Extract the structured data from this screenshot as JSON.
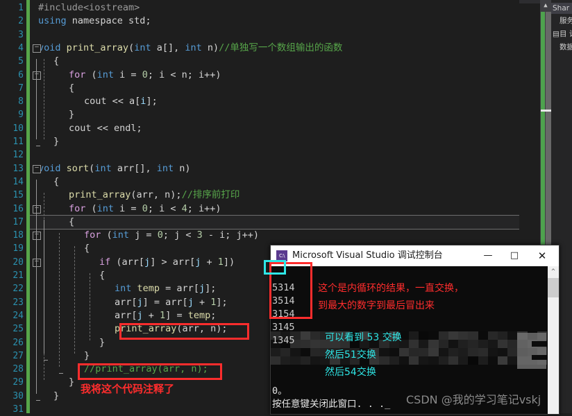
{
  "editor": {
    "language": "cpp",
    "first_line": 1,
    "last_line": 31,
    "current_line": 17,
    "line_numbers": [
      "1",
      "2",
      "3",
      "4",
      "5",
      "6",
      "7",
      "8",
      "9",
      "10",
      "11",
      "12",
      "13",
      "14",
      "15",
      "16",
      "17",
      "18",
      "19",
      "20",
      "21",
      "22",
      "23",
      "24",
      "25",
      "26",
      "27",
      "28",
      "29",
      "30",
      "31"
    ],
    "code_lines": [
      {
        "n": 1,
        "indent": 0,
        "tokens": [
          {
            "t": "#include<iostream>",
            "c": "pre"
          }
        ]
      },
      {
        "n": 2,
        "indent": 0,
        "tokens": [
          {
            "t": "using",
            "c": "kw"
          },
          {
            "t": " namespace ",
            "c": "id"
          },
          {
            "t": "std",
            "c": "id"
          },
          {
            "t": ";",
            "c": "br"
          }
        ]
      },
      {
        "n": 3,
        "indent": 0,
        "tokens": []
      },
      {
        "n": 4,
        "indent": 0,
        "tokens": [
          {
            "t": "void",
            "c": "kw"
          },
          {
            "t": " ",
            "c": "id"
          },
          {
            "t": "print_array",
            "c": "fn"
          },
          {
            "t": "(",
            "c": "br"
          },
          {
            "t": "int",
            "c": "kw"
          },
          {
            "t": " a[], ",
            "c": "id"
          },
          {
            "t": "int",
            "c": "kw"
          },
          {
            "t": " n",
            "c": "id"
          },
          {
            "t": ")",
            "c": "br"
          },
          {
            "t": "//单独写一个数组输出的函数",
            "c": "cmt"
          }
        ]
      },
      {
        "n": 5,
        "indent": 1,
        "tokens": [
          {
            "t": "{",
            "c": "br"
          }
        ]
      },
      {
        "n": 6,
        "indent": 2,
        "tokens": [
          {
            "t": "for",
            "c": "kw2"
          },
          {
            "t": " (",
            "c": "br"
          },
          {
            "t": "int",
            "c": "kw"
          },
          {
            "t": " i = ",
            "c": "id"
          },
          {
            "t": "0",
            "c": "num"
          },
          {
            "t": "; i < n; i++)",
            "c": "id"
          }
        ]
      },
      {
        "n": 7,
        "indent": 2,
        "tokens": [
          {
            "t": "{",
            "c": "br"
          }
        ]
      },
      {
        "n": 8,
        "indent": 3,
        "tokens": [
          {
            "t": "cout",
            "c": "id"
          },
          {
            "t": " << a[",
            "c": "id"
          },
          {
            "t": "i",
            "c": "var"
          },
          {
            "t": "];",
            "c": "id"
          }
        ]
      },
      {
        "n": 9,
        "indent": 2,
        "tokens": [
          {
            "t": "}",
            "c": "br"
          }
        ]
      },
      {
        "n": 10,
        "indent": 2,
        "tokens": [
          {
            "t": "cout",
            "c": "id"
          },
          {
            "t": " << endl;",
            "c": "id"
          }
        ]
      },
      {
        "n": 11,
        "indent": 1,
        "tokens": [
          {
            "t": "}",
            "c": "br"
          }
        ]
      },
      {
        "n": 12,
        "indent": 0,
        "tokens": []
      },
      {
        "n": 13,
        "indent": 0,
        "tokens": [
          {
            "t": "void",
            "c": "kw"
          },
          {
            "t": " ",
            "c": "id"
          },
          {
            "t": "sort",
            "c": "fn"
          },
          {
            "t": "(",
            "c": "br"
          },
          {
            "t": "int",
            "c": "kw"
          },
          {
            "t": " arr[], ",
            "c": "id"
          },
          {
            "t": "int",
            "c": "kw"
          },
          {
            "t": " n",
            "c": "id"
          },
          {
            "t": ")",
            "c": "br"
          }
        ]
      },
      {
        "n": 14,
        "indent": 1,
        "tokens": [
          {
            "t": "{",
            "c": "br"
          }
        ]
      },
      {
        "n": 15,
        "indent": 2,
        "tokens": [
          {
            "t": "print_array",
            "c": "fn"
          },
          {
            "t": "(arr, n);",
            "c": "id"
          },
          {
            "t": "//排序前打印",
            "c": "cmt"
          }
        ]
      },
      {
        "n": 16,
        "indent": 2,
        "tokens": [
          {
            "t": "for",
            "c": "kw2"
          },
          {
            "t": " (",
            "c": "br"
          },
          {
            "t": "int",
            "c": "kw"
          },
          {
            "t": " i = ",
            "c": "id"
          },
          {
            "t": "0",
            "c": "num"
          },
          {
            "t": "; i < ",
            "c": "id"
          },
          {
            "t": "4",
            "c": "num"
          },
          {
            "t": "; i++)",
            "c": "id"
          }
        ]
      },
      {
        "n": 17,
        "indent": 2,
        "tokens": [
          {
            "t": "{",
            "c": "br"
          }
        ]
      },
      {
        "n": 18,
        "indent": 3,
        "tokens": [
          {
            "t": "for",
            "c": "kw2"
          },
          {
            "t": " (",
            "c": "br"
          },
          {
            "t": "int",
            "c": "kw"
          },
          {
            "t": " j = ",
            "c": "id"
          },
          {
            "t": "0",
            "c": "num"
          },
          {
            "t": "; j < ",
            "c": "id"
          },
          {
            "t": "3",
            "c": "num"
          },
          {
            "t": " - i; j++)",
            "c": "id"
          }
        ]
      },
      {
        "n": 19,
        "indent": 3,
        "tokens": [
          {
            "t": "{",
            "c": "br"
          }
        ]
      },
      {
        "n": 20,
        "indent": 4,
        "tokens": [
          {
            "t": "if",
            "c": "kw2"
          },
          {
            "t": " (arr[",
            "c": "id"
          },
          {
            "t": "j",
            "c": "var"
          },
          {
            "t": "] > arr[",
            "c": "id"
          },
          {
            "t": "j",
            "c": "var"
          },
          {
            "t": " + ",
            "c": "id"
          },
          {
            "t": "1",
            "c": "num"
          },
          {
            "t": "])",
            "c": "id"
          }
        ]
      },
      {
        "n": 21,
        "indent": 4,
        "tokens": [
          {
            "t": "{",
            "c": "br"
          }
        ]
      },
      {
        "n": 22,
        "indent": 5,
        "tokens": [
          {
            "t": "int",
            "c": "kw"
          },
          {
            "t": " ",
            "c": "id"
          },
          {
            "t": "temp",
            "c": "fn"
          },
          {
            "t": " = arr[",
            "c": "id"
          },
          {
            "t": "j",
            "c": "var"
          },
          {
            "t": "];",
            "c": "id"
          }
        ]
      },
      {
        "n": 23,
        "indent": 5,
        "tokens": [
          {
            "t": "arr[",
            "c": "id"
          },
          {
            "t": "j",
            "c": "var"
          },
          {
            "t": "] = arr[",
            "c": "id"
          },
          {
            "t": "j",
            "c": "var"
          },
          {
            "t": " + ",
            "c": "id"
          },
          {
            "t": "1",
            "c": "num"
          },
          {
            "t": "];",
            "c": "id"
          }
        ]
      },
      {
        "n": 24,
        "indent": 5,
        "tokens": [
          {
            "t": "arr[",
            "c": "id"
          },
          {
            "t": "j",
            "c": "var"
          },
          {
            "t": " + ",
            "c": "id"
          },
          {
            "t": "1",
            "c": "num"
          },
          {
            "t": "] = ",
            "c": "id"
          },
          {
            "t": "temp",
            "c": "fn"
          },
          {
            "t": ";",
            "c": "id"
          }
        ]
      },
      {
        "n": 25,
        "indent": 5,
        "tokens": [
          {
            "t": "print_array",
            "c": "fn"
          },
          {
            "t": "(arr, n);",
            "c": "id"
          }
        ]
      },
      {
        "n": 26,
        "indent": 4,
        "tokens": [
          {
            "t": "}",
            "c": "br"
          }
        ]
      },
      {
        "n": 27,
        "indent": 3,
        "tokens": [
          {
            "t": "}",
            "c": "br"
          }
        ]
      },
      {
        "n": 28,
        "indent": 3,
        "tokens": [
          {
            "t": "//print_array(arr, n);",
            "c": "cmt"
          }
        ]
      },
      {
        "n": 29,
        "indent": 2,
        "tokens": [
          {
            "t": "}",
            "c": "br"
          }
        ]
      },
      {
        "n": 30,
        "indent": 1,
        "tokens": [
          {
            "t": "}",
            "c": "br"
          }
        ]
      },
      {
        "n": 31,
        "indent": 0,
        "tokens": []
      }
    ]
  },
  "right_tabs": [
    {
      "label": "Shar",
      "icon": "panel-icon",
      "selected": true
    },
    {
      "label": "服务",
      "icon": "services-icon",
      "selected": false
    },
    {
      "label": "目 诊",
      "icon": "toolbox-icon",
      "selected": false
    },
    {
      "label": "数据",
      "icon": "data-icon",
      "selected": false
    }
  ],
  "console": {
    "title": "Microsoft Visual Studio 调试控制台",
    "app_icon": "csn-icon",
    "minimize": "—",
    "maximize": "□",
    "close": "✕",
    "scroll_up_arrow": "^",
    "output_lines": [
      "5314",
      "3514",
      "3154",
      "3145",
      "1345"
    ],
    "exit_line": "0。",
    "press_key_line": "按任意键关闭此窗口. . ._",
    "notes_red": [
      "这个是内循环的结果，一直交换，",
      "到最大的数字到最后冒出来"
    ],
    "notes_cyan": [
      "可以看到 53 交换",
      "然后51交换",
      "然后54交换"
    ]
  },
  "annotations": {
    "red_box_code_1": "print_array(arr, n);",
    "red_box_code_2": "//print_array(arr, n);",
    "red_caption": "我将这个代码注释了",
    "red_box_console_output": "5314 / 3514 / 3154 / 3145",
    "cyan_box_console": "53",
    "colors": {
      "red": "#ff2d2d",
      "cyan": "#2ee6e6",
      "comment_green": "#57a64a",
      "changebar_green": "#57a64a"
    }
  },
  "watermark": {
    "text": "CSDN @我的学习笔记vskj"
  }
}
